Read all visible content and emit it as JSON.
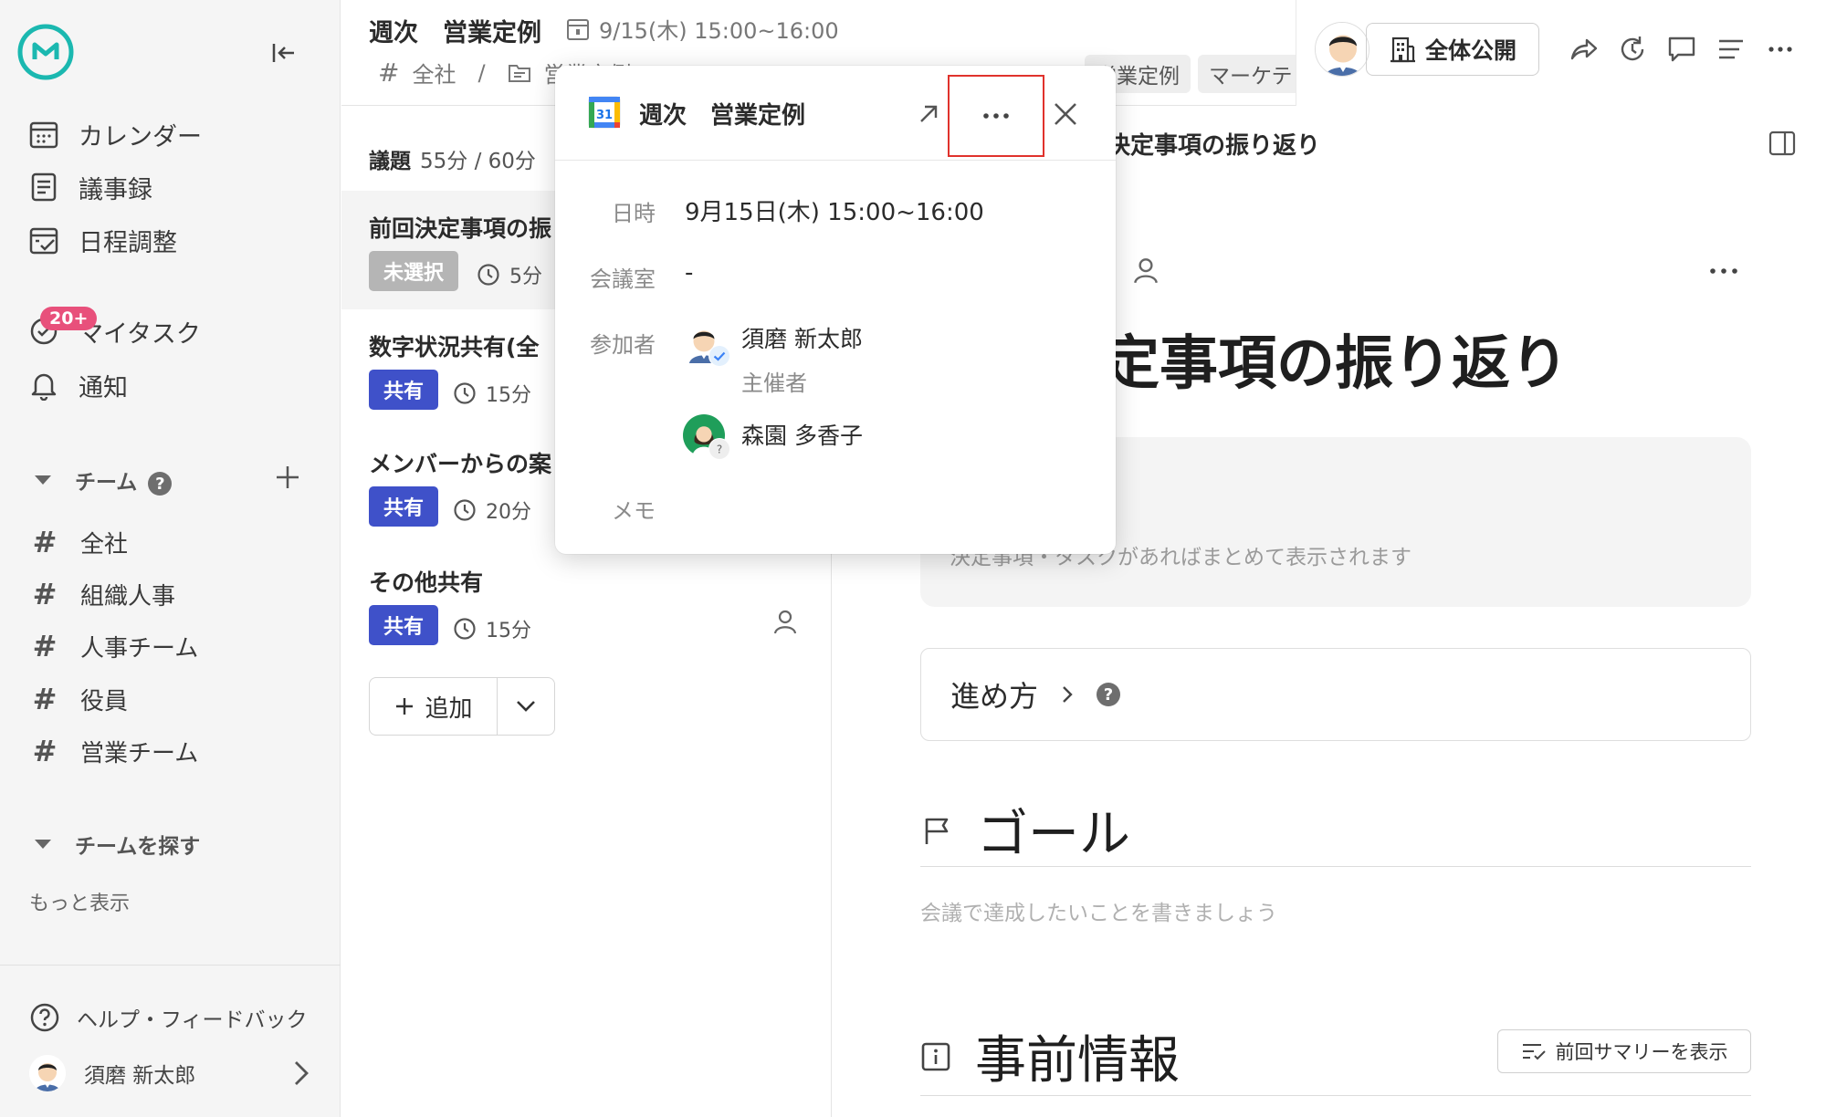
{
  "sidebar": {
    "nav": [
      {
        "label": "カレンダー",
        "icon": "calendar-icon"
      },
      {
        "label": "議事録",
        "icon": "document-icon"
      },
      {
        "label": "日程調整",
        "icon": "schedule-icon"
      },
      {
        "label": "マイタスク",
        "icon": "task-icon"
      },
      {
        "label": "通知",
        "icon": "bell-icon"
      }
    ],
    "task_badge": "20+",
    "teams_heading": "チーム",
    "teams_help": "?",
    "teams": [
      "全社",
      "組織人事",
      "人事チーム",
      "役員",
      "営業チーム"
    ],
    "find_teams_heading": "チームを探す",
    "more": "もっと表示",
    "help": "ヘルプ・フィードバック",
    "user_name": "須磨 新太郎"
  },
  "header": {
    "title": "週次　営業定例",
    "datetime": "9/15(木) 15:00~16:00",
    "breadcrumb_team": "全社",
    "breadcrumb_sep": "/",
    "breadcrumb_folder": "営業定例",
    "tags": [
      "営業定例",
      "マーケテ"
    ],
    "publish": "全体公開"
  },
  "agenda": {
    "heading": "議題",
    "time_summary": "55分 / 60分",
    "items": [
      {
        "title": "前回決定事項の振",
        "status": "未選択",
        "duration": "5分"
      },
      {
        "title": "数字状況共有(全",
        "status": "共有",
        "duration": "15分"
      },
      {
        "title": "メンバーからの案",
        "status": "共有",
        "duration": "20分"
      },
      {
        "title": "その他共有",
        "status": "共有",
        "duration": "15分"
      }
    ],
    "add": "追加"
  },
  "main": {
    "crumb": "決定事項の振り返り",
    "title": "定事項の振り返り",
    "summary_placeholder": "決定事項・タスクがあればまとめて表示されます",
    "howto": "進め方",
    "howto_help": "?",
    "goal_title": "ゴール",
    "goal_placeholder": "会議で達成したいことを書きましょう",
    "pre_info_title": "事前情報",
    "prev_summary": "前回サマリーを表示"
  },
  "popup": {
    "title": "週次　営業定例",
    "calendar_day": "31",
    "labels": {
      "datetime": "日時",
      "room": "会議室",
      "participants": "参加者",
      "memo": "メモ"
    },
    "datetime": "9月15日(木) 15:00~16:00",
    "room": "-",
    "participants": [
      {
        "name": "須磨 新太郎",
        "role": "主催者",
        "status": "accepted"
      },
      {
        "name": "森園 多香子",
        "role": "",
        "status": "unknown",
        "status_mark": "?"
      }
    ]
  },
  "colors": {
    "brand": "#1bb8b0",
    "primary_pill": "#3f51c9",
    "unselected_pill": "#b5b5b5",
    "badge": "#e8507b",
    "highlight": "#e0322c"
  }
}
